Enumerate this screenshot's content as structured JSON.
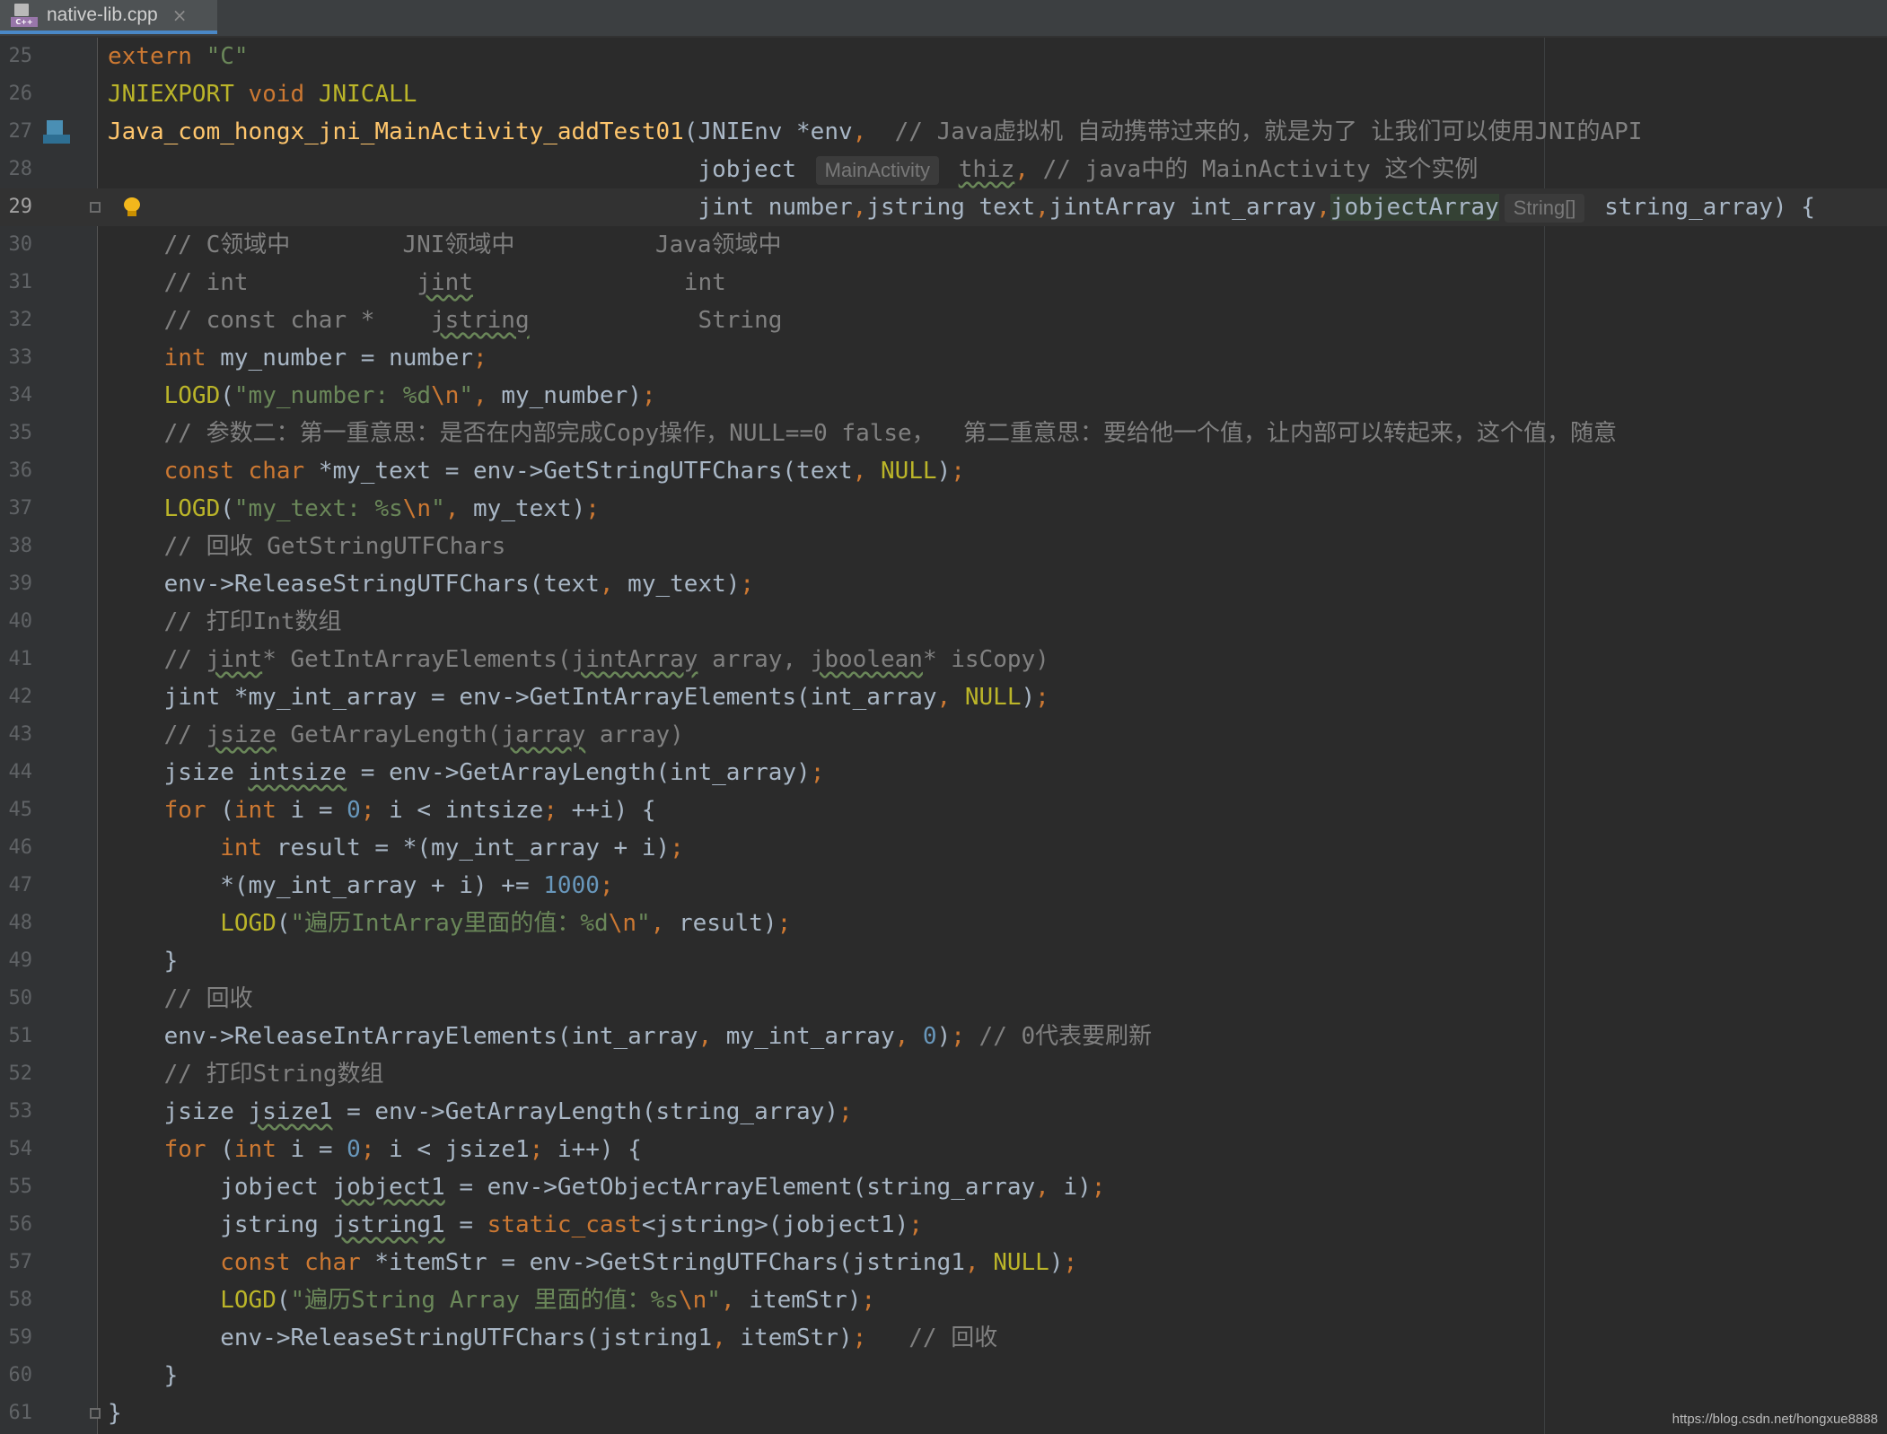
{
  "tab": {
    "title": "native-lib.cpp",
    "icon": "cpp-file-icon",
    "close": "×"
  },
  "hints": {
    "activity": "MainActivity",
    "strarr": "String[]"
  },
  "watermark": "https://blog.csdn.net/hongxue8888",
  "colors": {
    "background": "#2b2b2b",
    "keyword": "#cc7832",
    "string": "#6a8759",
    "number": "#6897bb",
    "comment": "#808080",
    "macro": "#bbb529",
    "function": "#ffc66d"
  },
  "lines": [
    {
      "n": "25",
      "c": [
        [
          "kw",
          "extern"
        ],
        [
          "p",
          " "
        ],
        [
          "str",
          "\"C\""
        ]
      ]
    },
    {
      "n": "26",
      "c": [
        [
          "mac",
          "JNIEXPORT"
        ],
        [
          "p",
          " "
        ],
        [
          "kw",
          "void"
        ],
        [
          "p",
          " "
        ],
        [
          "mac",
          "JNICALL"
        ]
      ]
    },
    {
      "n": "27",
      "c": [
        [
          "fn",
          "Java_com_hongx_jni_MainActivity_addTest01"
        ],
        [
          "p",
          "(JNIEnv *env"
        ],
        [
          "kw",
          ","
        ],
        [
          "p",
          "  "
        ],
        [
          "cmt",
          "// Java虚拟机 自动携带过来的，就是为了 让我们可以使用JNI的API"
        ]
      ]
    },
    {
      "n": "28",
      "c": [
        [
          "p",
          "                                          jobject "
        ],
        [
          "hint",
          "activity"
        ],
        [
          "p",
          " "
        ],
        [
          "wavy cmt",
          "thiz"
        ],
        [
          "kw",
          ","
        ],
        [
          "p",
          " "
        ],
        [
          "cmt",
          "// java中的 MainActivity 这个实例"
        ]
      ]
    },
    {
      "n": "29",
      "c": [
        [
          "p",
          "                                          jint number"
        ],
        [
          "kw",
          ","
        ],
        [
          "p",
          "jstring text"
        ],
        [
          "kw",
          ","
        ],
        [
          "p",
          "jintArray int_array"
        ],
        [
          "kw",
          ","
        ],
        [
          "hl",
          "jobjectArray"
        ],
        [
          "hint",
          "strarr"
        ],
        [
          "p",
          " string_array) {"
        ]
      ]
    },
    {
      "n": "30",
      "c": [
        [
          "cmt",
          "    // C领域中        JNI领域中          Java领域中"
        ]
      ]
    },
    {
      "n": "31",
      "c": [
        [
          "cmt",
          "    // int            "
        ],
        [
          "wavy cmt",
          "jint"
        ],
        [
          "cmt",
          "               int"
        ]
      ]
    },
    {
      "n": "32",
      "c": [
        [
          "cmt",
          "    // const char *    "
        ],
        [
          "wavy cmt",
          "jstring"
        ],
        [
          "cmt",
          "            String"
        ]
      ]
    },
    {
      "n": "33",
      "c": [
        [
          "p",
          "    "
        ],
        [
          "kw",
          "int"
        ],
        [
          "p",
          " my_number = number"
        ],
        [
          "kw",
          ";"
        ]
      ]
    },
    {
      "n": "34",
      "c": [
        [
          "p",
          "    "
        ],
        [
          "mac",
          "LOGD"
        ],
        [
          "p",
          "("
        ],
        [
          "str",
          "\"my_number: %d"
        ],
        [
          "esc",
          "\\n"
        ],
        [
          "str",
          "\""
        ],
        [
          "kw",
          ","
        ],
        [
          "p",
          " my_number)"
        ],
        [
          "kw",
          ";"
        ]
      ]
    },
    {
      "n": "35",
      "c": [
        [
          "cmt",
          "    // 参数二：第一重意思：是否在内部完成Copy操作，NULL==0 false，  第二重意思：要给他一个值，让内部可以转起来，这个值，随意"
        ]
      ]
    },
    {
      "n": "36",
      "c": [
        [
          "p",
          "    "
        ],
        [
          "kw",
          "const char"
        ],
        [
          "p",
          " *my_text = env->GetStringUTFChars(text"
        ],
        [
          "kw",
          ","
        ],
        [
          "p",
          " "
        ],
        [
          "mac",
          "NULL"
        ],
        [
          "p",
          ")"
        ],
        [
          "kw",
          ";"
        ]
      ]
    },
    {
      "n": "37",
      "c": [
        [
          "p",
          "    "
        ],
        [
          "mac",
          "LOGD"
        ],
        [
          "p",
          "("
        ],
        [
          "str",
          "\"my_text: %s"
        ],
        [
          "esc",
          "\\n"
        ],
        [
          "str",
          "\""
        ],
        [
          "kw",
          ","
        ],
        [
          "p",
          " my_text)"
        ],
        [
          "kw",
          ";"
        ]
      ]
    },
    {
      "n": "38",
      "c": [
        [
          "cmt",
          "    // 回收 GetStringUTFChars"
        ]
      ]
    },
    {
      "n": "39",
      "c": [
        [
          "p",
          "    env->ReleaseStringUTFChars(text"
        ],
        [
          "kw",
          ","
        ],
        [
          "p",
          " my_text)"
        ],
        [
          "kw",
          ";"
        ]
      ]
    },
    {
      "n": "40",
      "c": [
        [
          "cmt",
          "    // 打印Int数组"
        ]
      ]
    },
    {
      "n": "41",
      "c": [
        [
          "cmt",
          "    // "
        ],
        [
          "wavy cmt",
          "jint"
        ],
        [
          "cmt",
          "* GetIntArrayElements("
        ],
        [
          "wavy cmt",
          "jintArray"
        ],
        [
          "cmt",
          " array, "
        ],
        [
          "wavy cmt",
          "jboolean"
        ],
        [
          "cmt",
          "* isCopy)"
        ]
      ]
    },
    {
      "n": "42",
      "c": [
        [
          "p",
          "    jint *my_int_array = env->GetIntArrayElements(int_array"
        ],
        [
          "kw",
          ","
        ],
        [
          "p",
          " "
        ],
        [
          "mac",
          "NULL"
        ],
        [
          "p",
          ")"
        ],
        [
          "kw",
          ";"
        ]
      ]
    },
    {
      "n": "43",
      "c": [
        [
          "cmt",
          "    // "
        ],
        [
          "wavy cmt",
          "jsize"
        ],
        [
          "cmt",
          " GetArrayLength("
        ],
        [
          "wavy cmt",
          "jarray"
        ],
        [
          "cmt",
          " array)"
        ]
      ]
    },
    {
      "n": "44",
      "c": [
        [
          "p",
          "    jsize "
        ],
        [
          "wavy",
          "intsize"
        ],
        [
          "p",
          " = env->GetArrayLength(int_array)"
        ],
        [
          "kw",
          ";"
        ]
      ]
    },
    {
      "n": "45",
      "c": [
        [
          "p",
          "    "
        ],
        [
          "kw",
          "for"
        ],
        [
          "p",
          " ("
        ],
        [
          "kw",
          "int"
        ],
        [
          "p",
          " i = "
        ],
        [
          "num",
          "0"
        ],
        [
          "kw",
          ";"
        ],
        [
          "p",
          " i < intsize"
        ],
        [
          "kw",
          ";"
        ],
        [
          "p",
          " ++i) {"
        ]
      ]
    },
    {
      "n": "46",
      "c": [
        [
          "p",
          "        "
        ],
        [
          "kw",
          "int"
        ],
        [
          "p",
          " result = *(my_int_array + i)"
        ],
        [
          "kw",
          ";"
        ]
      ]
    },
    {
      "n": "47",
      "c": [
        [
          "p",
          "        *(my_int_array + i) += "
        ],
        [
          "num",
          "1000"
        ],
        [
          "kw",
          ";"
        ]
      ]
    },
    {
      "n": "48",
      "c": [
        [
          "p",
          "        "
        ],
        [
          "mac",
          "LOGD"
        ],
        [
          "p",
          "("
        ],
        [
          "str",
          "\"遍历IntArray里面的值：%d"
        ],
        [
          "esc",
          "\\n"
        ],
        [
          "str",
          "\""
        ],
        [
          "kw",
          ","
        ],
        [
          "p",
          " result)"
        ],
        [
          "kw",
          ";"
        ]
      ]
    },
    {
      "n": "49",
      "c": [
        [
          "p",
          "    }"
        ]
      ]
    },
    {
      "n": "50",
      "c": [
        [
          "cmt",
          "    // 回收"
        ]
      ]
    },
    {
      "n": "51",
      "c": [
        [
          "p",
          "    env->ReleaseIntArrayElements(int_array"
        ],
        [
          "kw",
          ","
        ],
        [
          "p",
          " my_int_array"
        ],
        [
          "kw",
          ","
        ],
        [
          "p",
          " "
        ],
        [
          "num",
          "0"
        ],
        [
          "p",
          ")"
        ],
        [
          "kw",
          ";"
        ],
        [
          "p",
          " "
        ],
        [
          "cmt",
          "// 0代表要刷新"
        ]
      ]
    },
    {
      "n": "52",
      "c": [
        [
          "cmt",
          "    // 打印String数组"
        ]
      ]
    },
    {
      "n": "53",
      "c": [
        [
          "p",
          "    jsize "
        ],
        [
          "wavy",
          "jsize1"
        ],
        [
          "p",
          " = env->GetArrayLength(string_array)"
        ],
        [
          "kw",
          ";"
        ]
      ]
    },
    {
      "n": "54",
      "c": [
        [
          "p",
          "    "
        ],
        [
          "kw",
          "for"
        ],
        [
          "p",
          " ("
        ],
        [
          "kw",
          "int"
        ],
        [
          "p",
          " i = "
        ],
        [
          "num",
          "0"
        ],
        [
          "kw",
          ";"
        ],
        [
          "p",
          " i < jsize1"
        ],
        [
          "kw",
          ";"
        ],
        [
          "p",
          " i++) {"
        ]
      ]
    },
    {
      "n": "55",
      "c": [
        [
          "p",
          "        jobject "
        ],
        [
          "wavy",
          "jobject1"
        ],
        [
          "p",
          " = env->GetObjectArrayElement(string_array"
        ],
        [
          "kw",
          ","
        ],
        [
          "p",
          " i)"
        ],
        [
          "kw",
          ";"
        ]
      ]
    },
    {
      "n": "56",
      "c": [
        [
          "p",
          "        jstring "
        ],
        [
          "wavy",
          "jstring1"
        ],
        [
          "p",
          " = "
        ],
        [
          "kw",
          "static_cast"
        ],
        [
          "p",
          "<jstring>(jobject1)"
        ],
        [
          "kw",
          ";"
        ]
      ]
    },
    {
      "n": "57",
      "c": [
        [
          "p",
          "        "
        ],
        [
          "kw",
          "const char"
        ],
        [
          "p",
          " *itemStr = env->GetStringUTFChars(jstring1"
        ],
        [
          "kw",
          ","
        ],
        [
          "p",
          " "
        ],
        [
          "mac",
          "NULL"
        ],
        [
          "p",
          ")"
        ],
        [
          "kw",
          ";"
        ]
      ]
    },
    {
      "n": "58",
      "c": [
        [
          "p",
          "        "
        ],
        [
          "mac",
          "LOGD"
        ],
        [
          "p",
          "("
        ],
        [
          "str",
          "\"遍历String Array 里面的值：%s"
        ],
        [
          "esc",
          "\\n"
        ],
        [
          "str",
          "\""
        ],
        [
          "kw",
          ","
        ],
        [
          "p",
          " itemStr)"
        ],
        [
          "kw",
          ";"
        ]
      ]
    },
    {
      "n": "59",
      "c": [
        [
          "p",
          "        env->ReleaseStringUTFChars(jstring1"
        ],
        [
          "kw",
          ","
        ],
        [
          "p",
          " itemStr)"
        ],
        [
          "kw",
          ";"
        ],
        [
          "p",
          "   "
        ],
        [
          "cmt",
          "// 回收"
        ]
      ]
    },
    {
      "n": "60",
      "c": [
        [
          "p",
          "    }"
        ]
      ]
    },
    {
      "n": "61",
      "c": [
        [
          "p",
          "}"
        ]
      ]
    }
  ]
}
